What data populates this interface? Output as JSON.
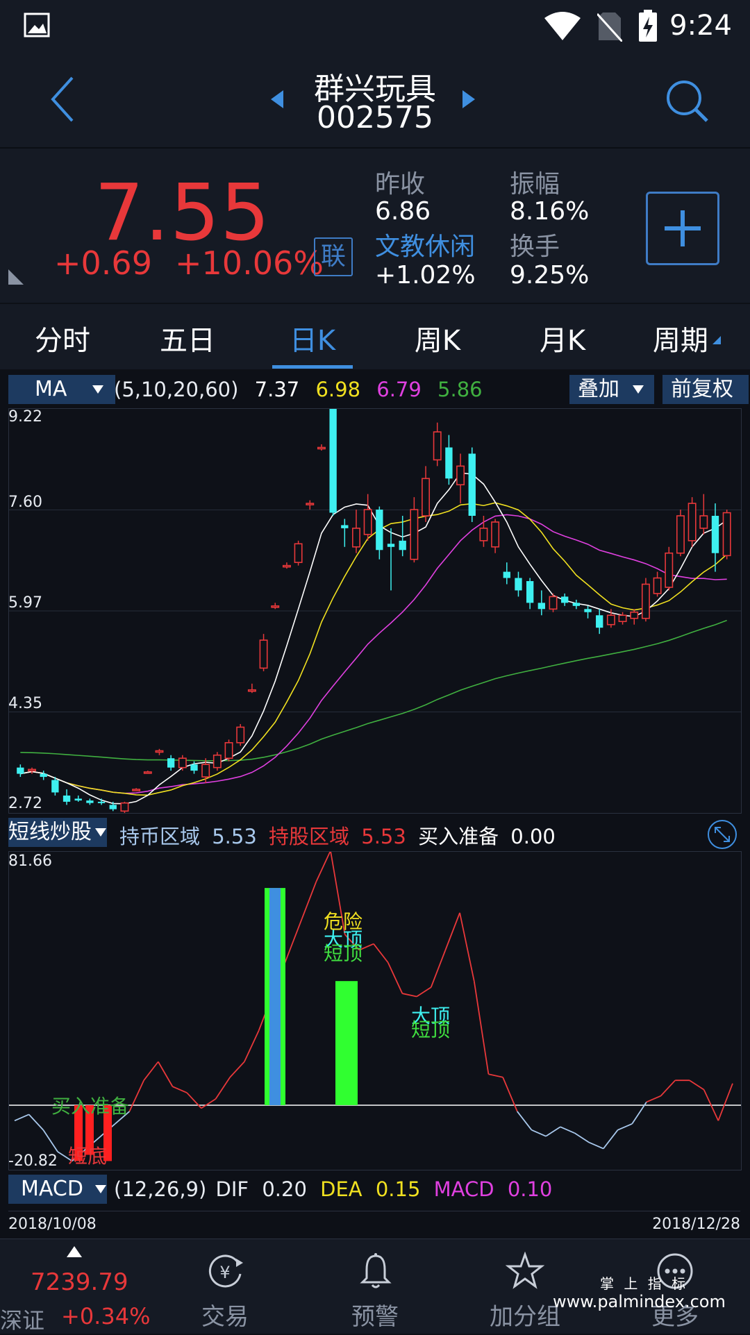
{
  "status_bar": {
    "time": "9:24"
  },
  "header": {
    "stock_name": "群兴玩具",
    "stock_code": "002575"
  },
  "quote": {
    "price": "7.55",
    "change": "+0.69",
    "change_pct": "+10.06%",
    "lian_label": "联",
    "prev_close_label": "昨收",
    "prev_close": "6.86",
    "amplitude_label": "振幅",
    "amplitude": "8.16%",
    "sector_label": "文教休闲",
    "sector_change": "+1.02%",
    "turnover_label": "换手",
    "turnover": "9.25%"
  },
  "tabs": [
    "分时",
    "五日",
    "日K",
    "周K",
    "月K",
    "周期"
  ],
  "active_tab": "日K",
  "ma_row": {
    "selector": "MA",
    "params": "(5,10,20,60)",
    "ma5": "7.37",
    "ma10": "6.98",
    "ma20": "6.79",
    "ma60": "5.86",
    "overlay_btn": "叠加",
    "adjust_btn": "前复权"
  },
  "kline_axis": [
    "9.22",
    "7.60",
    "5.97",
    "4.35",
    "2.72"
  ],
  "indicator_row": {
    "selector": "短线炒股",
    "hold_coin_label": "持币区域",
    "hold_coin_value": "5.53",
    "hold_stock_label": "持股区域",
    "hold_stock_value": "5.53",
    "buy_ready_label": "买入准备",
    "buy_ready_value": "0.00"
  },
  "indicator_axis": {
    "max": "81.66",
    "min": "-20.82"
  },
  "indicator_labels": {
    "buy_ready": "买入准备",
    "short_bottom": "短底",
    "danger": "危险",
    "big_top": "大顶",
    "short_top": "短顶",
    "big_top2": "大顶",
    "short_top2": "短顶"
  },
  "macd_row": {
    "selector": "MACD",
    "params": "(12,26,9)",
    "dif_label": "DIF",
    "dif": "0.20",
    "dea_label": "DEA",
    "dea": "0.15",
    "macd_label": "MACD",
    "macd": "0.10"
  },
  "date_range": {
    "start": "2018/10/08",
    "end": "2018/12/28"
  },
  "index": {
    "value": "7239.79",
    "name": "深证",
    "change_pct": "+0.34%"
  },
  "nav": [
    "交易",
    "预警",
    "加分组",
    "更多"
  ],
  "watermark": {
    "line1": "掌 上 指 标",
    "line2": "www.palmindex.com"
  },
  "colors": {
    "up": "#e8383a",
    "down": "#3ef0f0",
    "accent": "#3f8fe0",
    "ma5": "#ffffff",
    "ma10": "#f0e020",
    "ma20": "#e040e0",
    "ma60": "#40b040"
  },
  "chart_data": {
    "type": "candlestick",
    "price_axis": [
      9.22,
      7.6,
      5.97,
      4.35,
      2.72
    ],
    "candles": [
      {
        "o": 3.45,
        "h": 3.5,
        "l": 3.3,
        "c": 3.35
      },
      {
        "o": 3.4,
        "h": 3.45,
        "l": 3.35,
        "c": 3.42
      },
      {
        "o": 3.35,
        "h": 3.4,
        "l": 3.25,
        "c": 3.3
      },
      {
        "o": 3.25,
        "h": 3.3,
        "l": 3.0,
        "c": 3.05
      },
      {
        "o": 3.0,
        "h": 3.1,
        "l": 2.85,
        "c": 2.9
      },
      {
        "o": 2.95,
        "h": 3.0,
        "l": 2.9,
        "c": 2.92
      },
      {
        "o": 2.92,
        "h": 2.95,
        "l": 2.85,
        "c": 2.88
      },
      {
        "o": 2.9,
        "h": 2.95,
        "l": 2.85,
        "c": 2.88
      },
      {
        "o": 2.85,
        "h": 2.9,
        "l": 2.75,
        "c": 2.78
      },
      {
        "o": 2.75,
        "h": 2.9,
        "l": 2.72,
        "c": 2.88
      },
      {
        "o": 3.1,
        "h": 3.12,
        "l": 3.08,
        "c": 3.1
      },
      {
        "o": 3.38,
        "h": 3.4,
        "l": 3.36,
        "c": 3.38
      },
      {
        "o": 3.7,
        "h": 3.75,
        "l": 3.65,
        "c": 3.72
      },
      {
        "o": 3.6,
        "h": 3.65,
        "l": 3.4,
        "c": 3.45
      },
      {
        "o": 3.45,
        "h": 3.65,
        "l": 3.4,
        "c": 3.6
      },
      {
        "o": 3.5,
        "h": 3.55,
        "l": 3.35,
        "c": 3.4
      },
      {
        "o": 3.3,
        "h": 3.6,
        "l": 3.2,
        "c": 3.5
      },
      {
        "o": 3.45,
        "h": 3.7,
        "l": 3.4,
        "c": 3.65
      },
      {
        "o": 3.6,
        "h": 3.9,
        "l": 3.55,
        "c": 3.85
      },
      {
        "o": 3.85,
        "h": 4.15,
        "l": 3.8,
        "c": 4.1
      },
      {
        "o": 4.7,
        "h": 4.8,
        "l": 4.65,
        "c": 4.7
      },
      {
        "o": 5.05,
        "h": 5.6,
        "l": 5.0,
        "c": 5.5
      },
      {
        "o": 6.05,
        "h": 6.1,
        "l": 6.0,
        "c": 6.05
      },
      {
        "o": 6.7,
        "h": 6.75,
        "l": 6.65,
        "c": 6.7
      },
      {
        "o": 6.75,
        "h": 7.1,
        "l": 6.7,
        "c": 7.05
      },
      {
        "o": 7.7,
        "h": 7.75,
        "l": 7.6,
        "c": 7.7
      },
      {
        "o": 8.6,
        "h": 8.65,
        "l": 8.55,
        "c": 8.6
      },
      {
        "o": 9.22,
        "h": 9.22,
        "l": 7.5,
        "c": 7.55
      },
      {
        "o": 7.35,
        "h": 7.45,
        "l": 7.0,
        "c": 7.3
      },
      {
        "o": 7.0,
        "h": 7.6,
        "l": 6.9,
        "c": 7.3
      },
      {
        "o": 7.2,
        "h": 7.85,
        "l": 7.1,
        "c": 7.6
      },
      {
        "o": 7.6,
        "h": 7.65,
        "l": 6.8,
        "c": 6.95
      },
      {
        "o": 7.05,
        "h": 7.3,
        "l": 6.3,
        "c": 7.0
      },
      {
        "o": 7.1,
        "h": 7.5,
        "l": 6.85,
        "c": 6.95
      },
      {
        "o": 6.8,
        "h": 7.8,
        "l": 6.75,
        "c": 7.6
      },
      {
        "o": 7.5,
        "h": 8.3,
        "l": 7.4,
        "c": 8.1
      },
      {
        "o": 8.4,
        "h": 9.0,
        "l": 8.3,
        "c": 8.85
      },
      {
        "o": 8.6,
        "h": 8.8,
        "l": 8.0,
        "c": 8.1
      },
      {
        "o": 8.0,
        "h": 8.5,
        "l": 7.7,
        "c": 8.3
      },
      {
        "o": 8.5,
        "h": 8.6,
        "l": 7.4,
        "c": 7.5
      },
      {
        "o": 7.1,
        "h": 7.5,
        "l": 7.0,
        "c": 7.3
      },
      {
        "o": 7.0,
        "h": 7.45,
        "l": 6.9,
        "c": 7.4
      },
      {
        "o": 6.6,
        "h": 6.75,
        "l": 6.4,
        "c": 6.5
      },
      {
        "o": 6.5,
        "h": 6.6,
        "l": 6.2,
        "c": 6.3
      },
      {
        "o": 6.45,
        "h": 6.5,
        "l": 6.0,
        "c": 6.1
      },
      {
        "o": 6.1,
        "h": 6.3,
        "l": 5.9,
        "c": 6.0
      },
      {
        "o": 6.0,
        "h": 6.25,
        "l": 5.95,
        "c": 6.2
      },
      {
        "o": 6.2,
        "h": 6.25,
        "l": 6.05,
        "c": 6.1
      },
      {
        "o": 6.1,
        "h": 6.15,
        "l": 6.0,
        "c": 6.05
      },
      {
        "o": 6.0,
        "h": 6.05,
        "l": 5.85,
        "c": 5.95
      },
      {
        "o": 5.9,
        "h": 6.0,
        "l": 5.6,
        "c": 5.7
      },
      {
        "o": 5.75,
        "h": 6.0,
        "l": 5.7,
        "c": 5.9
      },
      {
        "o": 5.8,
        "h": 5.95,
        "l": 5.75,
        "c": 5.9
      },
      {
        "o": 5.85,
        "h": 6.0,
        "l": 5.75,
        "c": 5.95
      },
      {
        "o": 5.85,
        "h": 6.5,
        "l": 5.8,
        "c": 6.4
      },
      {
        "o": 6.25,
        "h": 6.6,
        "l": 6.2,
        "c": 6.5
      },
      {
        "o": 6.35,
        "h": 7.0,
        "l": 6.3,
        "c": 6.9
      },
      {
        "o": 6.9,
        "h": 7.6,
        "l": 6.85,
        "c": 7.5
      },
      {
        "o": 7.1,
        "h": 7.8,
        "l": 7.0,
        "c": 7.7
      },
      {
        "o": 7.3,
        "h": 7.85,
        "l": 7.2,
        "c": 7.5
      },
      {
        "o": 7.5,
        "h": 7.7,
        "l": 6.6,
        "c": 6.9
      },
      {
        "o": 6.86,
        "h": 7.6,
        "l": 6.8,
        "c": 7.55
      }
    ]
  }
}
